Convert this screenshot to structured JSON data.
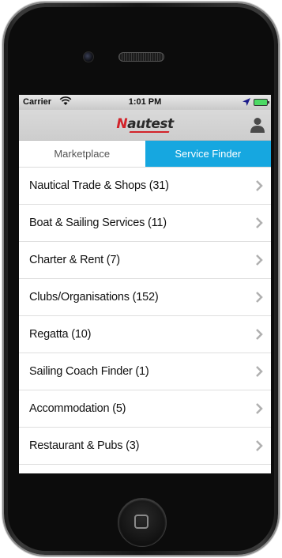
{
  "status_bar": {
    "carrier": "Carrier",
    "time": "1:01 PM"
  },
  "nav_bar": {
    "logo_initial": "N",
    "logo_rest": "autest"
  },
  "tabs": [
    {
      "label": "Marketplace",
      "active": false
    },
    {
      "label": "Service Finder",
      "active": true
    }
  ],
  "categories": [
    {
      "label": "Nautical Trade & Shops (31)"
    },
    {
      "label": "Boat & Sailing Services (11)"
    },
    {
      "label": "Charter & Rent (7)"
    },
    {
      "label": "Clubs/Organisations (152)"
    },
    {
      "label": "Regatta (10)"
    },
    {
      "label": "Sailing Coach Finder (1)"
    },
    {
      "label": "Accommodation (5)"
    },
    {
      "label": "Restaurant & Pubs (3)"
    }
  ],
  "colors": {
    "accent": "#16a7e0",
    "brand": "#d2232a"
  }
}
